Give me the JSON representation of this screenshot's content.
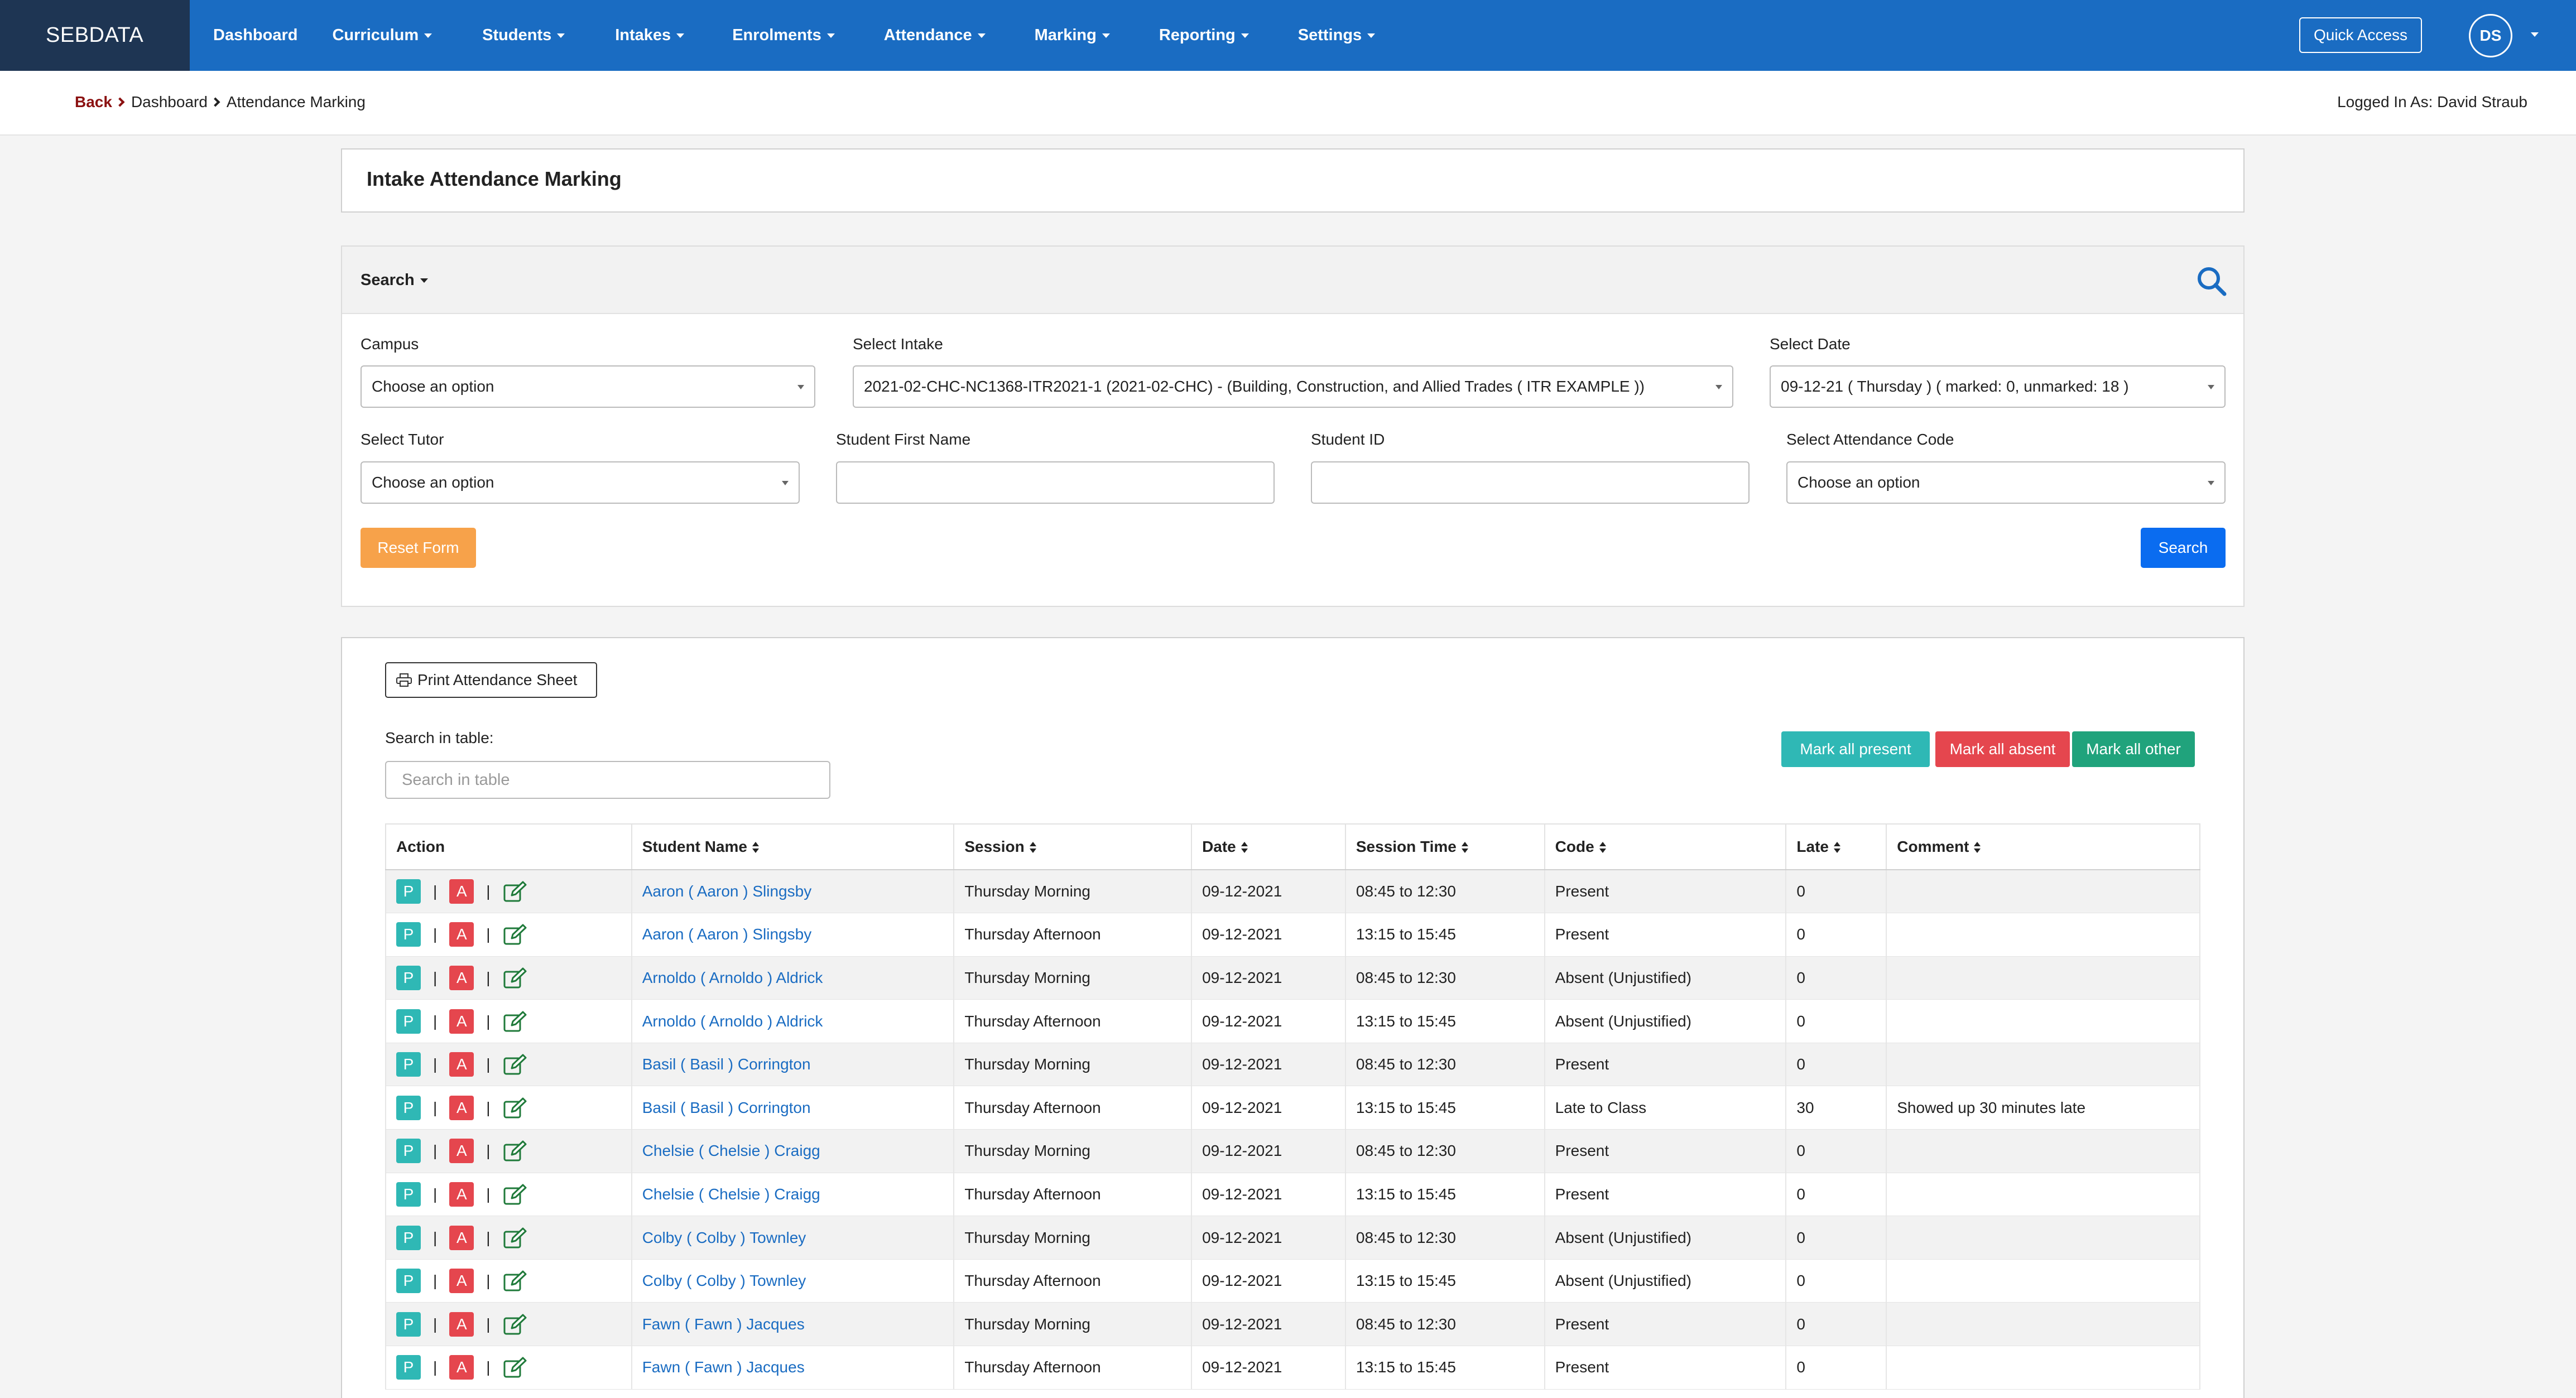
{
  "nav": {
    "brand": "SEBDATA",
    "items": [
      {
        "label": "Dashboard",
        "dropdown": false
      },
      {
        "label": "Curriculum",
        "dropdown": true
      },
      {
        "label": "Students",
        "dropdown": true
      },
      {
        "label": "Intakes",
        "dropdown": true
      },
      {
        "label": "Enrolments",
        "dropdown": true
      },
      {
        "label": "Attendance",
        "dropdown": true
      },
      {
        "label": "Marking",
        "dropdown": true
      },
      {
        "label": "Reporting",
        "dropdown": true
      },
      {
        "label": "Settings",
        "dropdown": true
      }
    ],
    "quick_access": "Quick Access",
    "avatar_initials": "DS"
  },
  "breadcrumb": {
    "back": "Back",
    "items": [
      "Dashboard",
      "Attendance Marking"
    ],
    "logged_in": "Logged In As: David Straub"
  },
  "page_title": "Intake Attendance Marking",
  "search": {
    "toggle_label": "Search",
    "campus": {
      "label": "Campus",
      "value": "Choose an option"
    },
    "intake": {
      "label": "Select Intake",
      "value": "2021-02-CHC-NC1368-ITR2021-1 (2021-02-CHC) - (Building, Construction, and Allied Trades ( ITR EXAMPLE ))"
    },
    "date": {
      "label": "Select Date",
      "value": "09-12-21 ( Thursday ) ( marked: 0, unmarked: 18 )"
    },
    "tutor": {
      "label": "Select Tutor",
      "value": "Choose an option"
    },
    "first_name": {
      "label": "Student First Name",
      "value": ""
    },
    "student_id": {
      "label": "Student ID",
      "value": ""
    },
    "attendance_code": {
      "label": "Select Attendance Code",
      "value": "Choose an option"
    },
    "reset_label": "Reset Form",
    "search_label": "Search"
  },
  "table_section": {
    "print_label": "Print Attendance Sheet",
    "search_label": "Search in table:",
    "search_placeholder": "Search in table",
    "mark_present": "Mark all present",
    "mark_absent": "Mark all absent",
    "mark_other": "Mark all other",
    "columns": [
      "Action",
      "Student Name",
      "Session",
      "Date",
      "Session Time",
      "Code",
      "Late",
      "Comment"
    ],
    "action_p": "P",
    "action_a": "A",
    "rows": [
      {
        "name": "Aaron ( Aaron ) Slingsby",
        "session": "Thursday Morning",
        "date": "09-12-2021",
        "time": "08:45 to 12:30",
        "code": "Present",
        "late": "0",
        "comment": ""
      },
      {
        "name": "Aaron ( Aaron ) Slingsby",
        "session": "Thursday Afternoon",
        "date": "09-12-2021",
        "time": "13:15 to 15:45",
        "code": "Present",
        "late": "0",
        "comment": ""
      },
      {
        "name": "Arnoldo ( Arnoldo ) Aldrick",
        "session": "Thursday Morning",
        "date": "09-12-2021",
        "time": "08:45 to 12:30",
        "code": "Absent (Unjustified)",
        "late": "0",
        "comment": ""
      },
      {
        "name": "Arnoldo ( Arnoldo ) Aldrick",
        "session": "Thursday Afternoon",
        "date": "09-12-2021",
        "time": "13:15 to 15:45",
        "code": "Absent (Unjustified)",
        "late": "0",
        "comment": ""
      },
      {
        "name": "Basil ( Basil ) Corrington",
        "session": "Thursday Morning",
        "date": "09-12-2021",
        "time": "08:45 to 12:30",
        "code": "Present",
        "late": "0",
        "comment": ""
      },
      {
        "name": "Basil ( Basil ) Corrington",
        "session": "Thursday Afternoon",
        "date": "09-12-2021",
        "time": "13:15 to 15:45",
        "code": "Late to Class",
        "late": "30",
        "comment": "Showed up 30 minutes late"
      },
      {
        "name": "Chelsie ( Chelsie ) Craigg",
        "session": "Thursday Morning",
        "date": "09-12-2021",
        "time": "08:45 to 12:30",
        "code": "Present",
        "late": "0",
        "comment": ""
      },
      {
        "name": "Chelsie ( Chelsie ) Craigg",
        "session": "Thursday Afternoon",
        "date": "09-12-2021",
        "time": "13:15 to 15:45",
        "code": "Present",
        "late": "0",
        "comment": ""
      },
      {
        "name": "Colby ( Colby ) Townley",
        "session": "Thursday Morning",
        "date": "09-12-2021",
        "time": "08:45 to 12:30",
        "code": "Absent (Unjustified)",
        "late": "0",
        "comment": ""
      },
      {
        "name": "Colby ( Colby ) Townley",
        "session": "Thursday Afternoon",
        "date": "09-12-2021",
        "time": "13:15 to 15:45",
        "code": "Absent (Unjustified)",
        "late": "0",
        "comment": ""
      },
      {
        "name": "Fawn ( Fawn ) Jacques",
        "session": "Thursday Morning",
        "date": "09-12-2021",
        "time": "08:45 to 12:30",
        "code": "Present",
        "late": "0",
        "comment": ""
      },
      {
        "name": "Fawn ( Fawn ) Jacques",
        "session": "Thursday Afternoon",
        "date": "09-12-2021",
        "time": "13:15 to 15:45",
        "code": "Present",
        "late": "0",
        "comment": ""
      }
    ]
  },
  "colors": {
    "navbar": "#1a6cc2",
    "brand_bg": "#1e3553",
    "present": "#2fb8b5",
    "absent": "#e5464e",
    "other": "#20a37c",
    "reset": "#f7a24a",
    "search_button": "#0a6cf0",
    "link": "#1a6cc2"
  }
}
